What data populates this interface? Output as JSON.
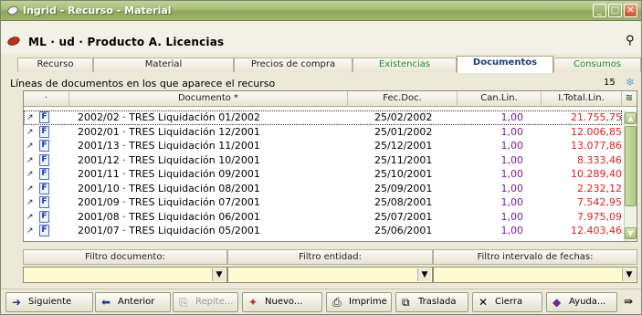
{
  "window": {
    "title": "Ingrid - Recurso - Material",
    "minimize": "_",
    "maximize": "□",
    "close": "✕"
  },
  "header": {
    "title": "ML · ud · Producto A. Licencias",
    "binoculars_icon": "binoculars-icon"
  },
  "tabs": [
    {
      "label": "Recurso"
    },
    {
      "label": "Material"
    },
    {
      "label": "Precios de compra"
    },
    {
      "label": "Existencias"
    },
    {
      "label": "Documentos"
    },
    {
      "label": "Consumos"
    }
  ],
  "list": {
    "caption": "Líneas de documentos en los que aparece el recurso",
    "count": "15",
    "columns": {
      "dot": "·",
      "documento": "Documento *",
      "fecha": "Fec.Doc.",
      "cantidad": "Can.Lin.",
      "total": "I.Total.Lin."
    },
    "rows": [
      {
        "doc": "2002/02 · TRES Liquidación 01/2002",
        "fecha": "25/02/2002",
        "cantidad": "1,00",
        "total": "21.755,75"
      },
      {
        "doc": "2002/01 · TRES Liquidación 12/2001",
        "fecha": "25/01/2002",
        "cantidad": "1,00",
        "total": "12.006,85"
      },
      {
        "doc": "2001/13 · TRES Liquidación 11/2001",
        "fecha": "25/12/2001",
        "cantidad": "1,00",
        "total": "13.077,86"
      },
      {
        "doc": "2001/12 · TRES Liquidación 10/2001",
        "fecha": "25/11/2001",
        "cantidad": "1,00",
        "total": "8.333,46"
      },
      {
        "doc": "2001/11 · TRES Liquidación 09/2001",
        "fecha": "25/10/2001",
        "cantidad": "1,00",
        "total": "10.289,40"
      },
      {
        "doc": "2001/10 · TRES Liquidación 08/2001",
        "fecha": "25/09/2001",
        "cantidad": "1,00",
        "total": "2.232,12"
      },
      {
        "doc": "2001/09 · TRES Liquidación 07/2001",
        "fecha": "25/08/2001",
        "cantidad": "1,00",
        "total": "7.542,95"
      },
      {
        "doc": "2001/08 · TRES Liquidación 06/2001",
        "fecha": "25/07/2001",
        "cantidad": "1,00",
        "total": "7.975,09"
      },
      {
        "doc": "2001/07 · TRES Liquidación 05/2001",
        "fecha": "25/06/2001",
        "cantidad": "1,00",
        "total": "12.403,46"
      }
    ]
  },
  "filters": {
    "documento_label": "Filtro documento:",
    "entidad_label": "Filtro entidad:",
    "fechas_label": "Filtro intervalo de fechas:"
  },
  "toolbar": {
    "siguiente": "Siguiente",
    "anterior": "Anterior",
    "repite": "Repite...",
    "nuevo": "Nuevo...",
    "imprime": "Imprime",
    "traslada": "Traslada",
    "cierra": "Cierra",
    "ayuda": "Ayuda..."
  },
  "colors": {
    "title_bar": "#9fb46b",
    "active_tab_text": "#1f3d7a",
    "quantity_text": "#7a1a9a",
    "total_text": "#e02020",
    "filter_field": "#fffbd0"
  }
}
